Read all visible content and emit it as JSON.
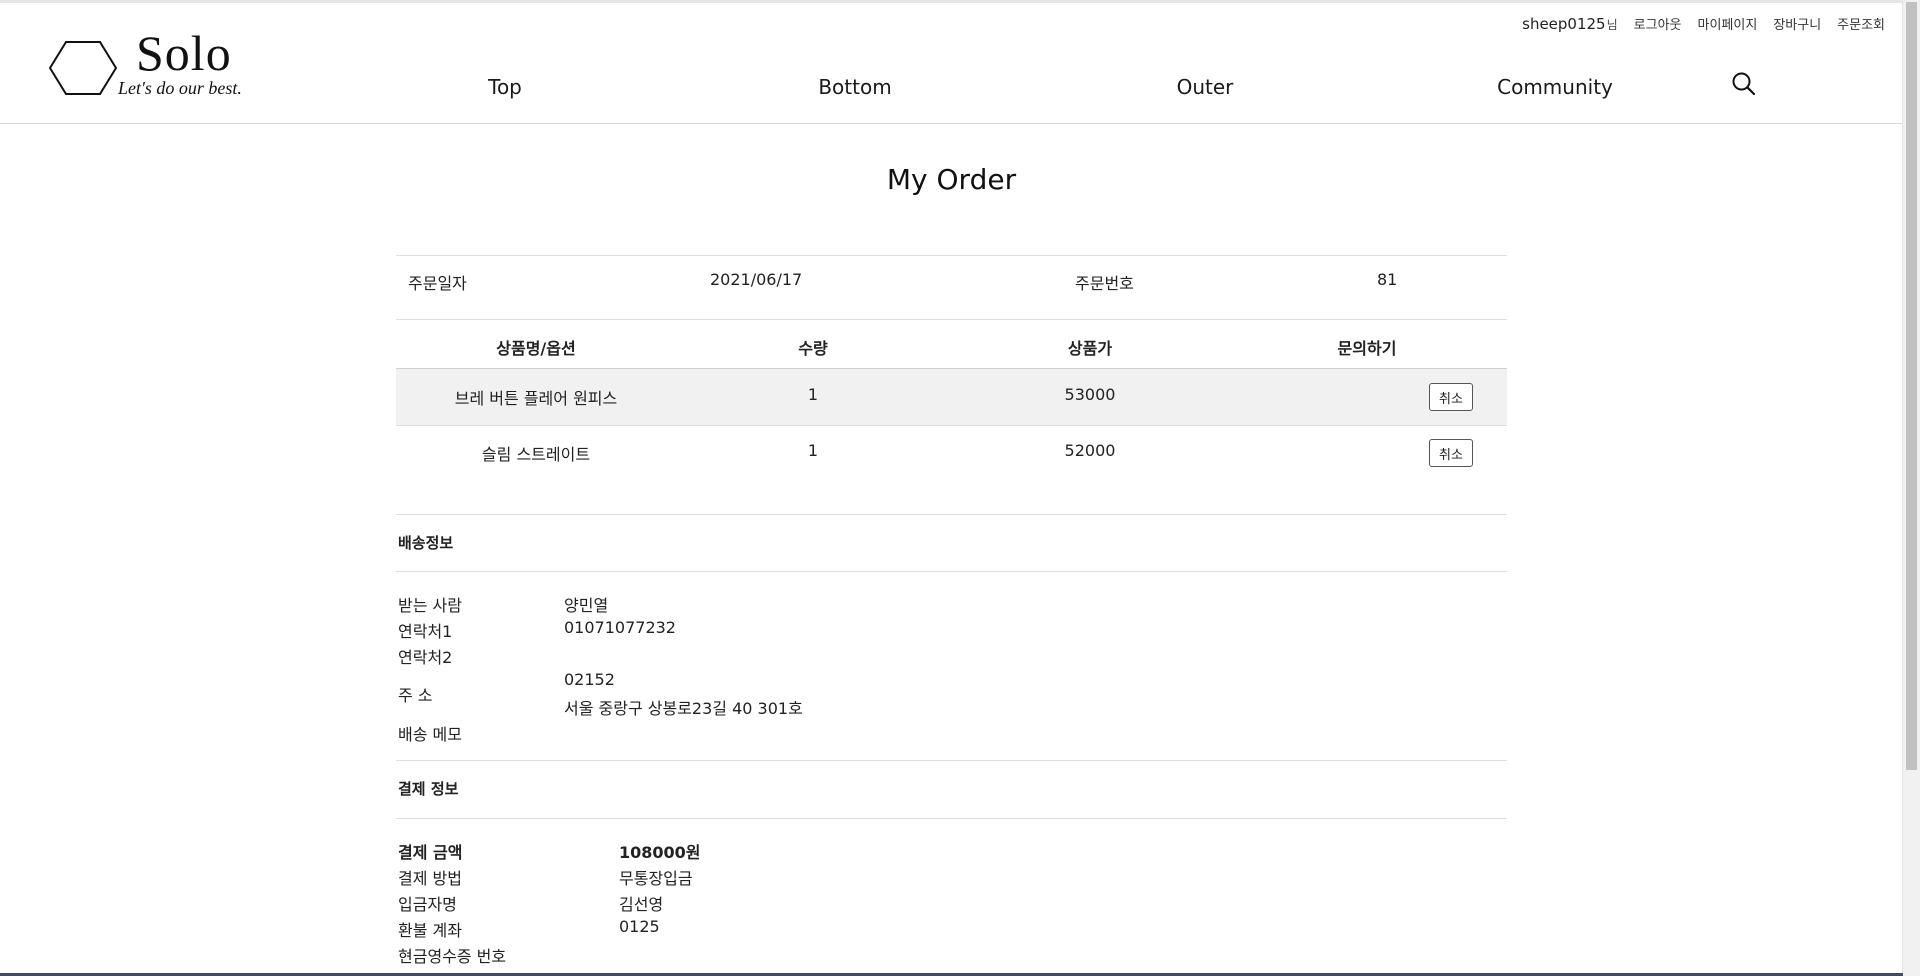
{
  "brand": {
    "name": "Solo",
    "tagline": "Let's do our best."
  },
  "util": {
    "username": "sheep0125",
    "suffix": "님",
    "links": [
      "로그아웃",
      "마이페이지",
      "장바구니",
      "주문조회"
    ]
  },
  "nav": [
    "Top",
    "Bottom",
    "Outer",
    "Community"
  ],
  "page_title": "My Order",
  "order": {
    "date_label": "주문일자",
    "date": "2021/06/17",
    "number_label": "주문번호",
    "number": "81"
  },
  "table": {
    "headers": [
      "상품명/옵션",
      "수량",
      "상품가",
      "문의하기"
    ],
    "rows": [
      {
        "name": "브레 버튼 플레어 원피스",
        "qty": "1",
        "price": "53000",
        "action": "취소"
      },
      {
        "name": "슬림 스트레이트",
        "qty": "1",
        "price": "52000",
        "action": "취소"
      }
    ]
  },
  "shipping": {
    "title": "배송정보",
    "recipient_label": "받는 사람",
    "recipient": "양민열",
    "phone1_label": "연락처1",
    "phone1": "01071077232",
    "phone2_label": "연락처2",
    "phone2": "",
    "address_label": "주 소",
    "zipcode": "02152",
    "address": "서울 중랑구 상봉로23길 40 301호",
    "memo_label": "배송 메모",
    "memo": ""
  },
  "payment": {
    "title": "결제 정보",
    "amount_label": "결제 금액",
    "amount": "108000원",
    "method_label": "결제 방법",
    "method": "무통장입금",
    "depositor_label": "입금자명",
    "depositor": "김선영",
    "refund_label": "환불 계좌",
    "refund": "0125",
    "receipt_label": "현금영수증 번호",
    "receipt": ""
  },
  "colors": {
    "shade": "#f1f1f1",
    "divider": "#dedede",
    "text": "#222222"
  },
  "icons": {
    "logo": "hexagon-icon",
    "search": "search-icon"
  }
}
